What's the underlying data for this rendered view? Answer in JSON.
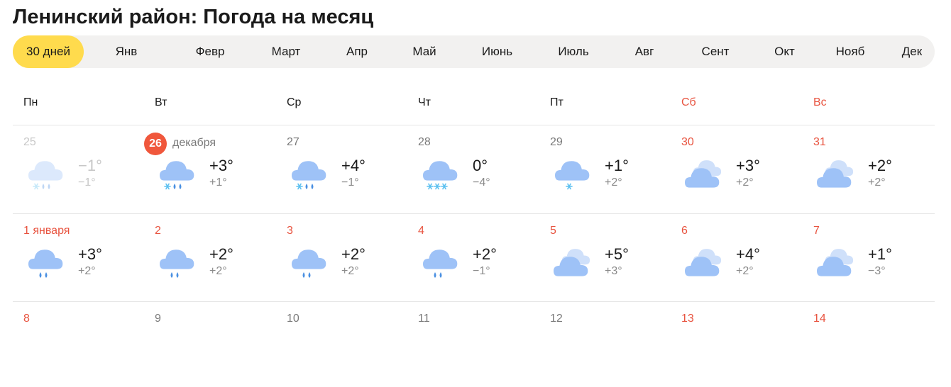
{
  "title": "Ленинский район: Погода на месяц",
  "tabs": [
    "30 дней",
    "Янв",
    "Февр",
    "Март",
    "Апр",
    "Май",
    "Июнь",
    "Июль",
    "Авг",
    "Сент",
    "Окт",
    "Нояб",
    "Дек"
  ],
  "active_tab": 0,
  "weekdays": [
    {
      "label": "Пн",
      "weekend": false
    },
    {
      "label": "Вт",
      "weekend": false
    },
    {
      "label": "Ср",
      "weekend": false
    },
    {
      "label": "Чт",
      "weekend": false
    },
    {
      "label": "Пт",
      "weekend": false
    },
    {
      "label": "Сб",
      "weekend": true
    },
    {
      "label": "Вс",
      "weekend": true
    }
  ],
  "colors": {
    "accent": "#ffdb4d",
    "today": "#f0573c",
    "weekend": "#e8533f",
    "cloud": "#9ec2f7",
    "cloud_back": "#cfe0fa",
    "drop": "#4a90e2",
    "snow": "#5bc0f0"
  },
  "rows": [
    [
      {
        "date": "25",
        "icon": "cloud-snow-rain-icon",
        "tmax": "−1°",
        "tmin": "−1°",
        "past": true
      },
      {
        "date": "26",
        "month": "декабря",
        "today": true,
        "icon": "cloud-snow-rain-icon",
        "tmax": "+3°",
        "tmin": "+1°"
      },
      {
        "date": "27",
        "icon": "cloud-snow-rain-icon",
        "tmax": "+4°",
        "tmin": "−1°"
      },
      {
        "date": "28",
        "icon": "cloud-snow-icon",
        "tmax": "0°",
        "tmin": "−4°"
      },
      {
        "date": "29",
        "icon": "cloud-light-snow-icon",
        "tmax": "+1°",
        "tmin": "+2°"
      },
      {
        "date": "30",
        "icon": "overcast-icon",
        "tmax": "+3°",
        "tmin": "+2°",
        "weekend": true
      },
      {
        "date": "31",
        "icon": "overcast-icon",
        "tmax": "+2°",
        "tmin": "+2°",
        "weekend": true
      }
    ],
    [
      {
        "date": "1 января",
        "icon": "cloud-rain-icon",
        "tmax": "+3°",
        "tmin": "+2°",
        "weekend": true
      },
      {
        "date": "2",
        "icon": "cloud-rain-icon",
        "tmax": "+2°",
        "tmin": "+2°",
        "weekend": true
      },
      {
        "date": "3",
        "icon": "cloud-rain-icon",
        "tmax": "+2°",
        "tmin": "+2°",
        "weekend": true
      },
      {
        "date": "4",
        "icon": "cloud-rain-icon",
        "tmax": "+2°",
        "tmin": "−1°",
        "weekend": true
      },
      {
        "date": "5",
        "icon": "overcast-icon",
        "tmax": "+5°",
        "tmin": "+3°",
        "weekend": true
      },
      {
        "date": "6",
        "icon": "overcast-icon",
        "tmax": "+4°",
        "tmin": "+2°",
        "weekend": true
      },
      {
        "date": "7",
        "icon": "overcast-icon",
        "tmax": "+1°",
        "tmin": "−3°",
        "weekend": true
      }
    ],
    [
      {
        "date": "8",
        "weekend": true
      },
      {
        "date": "9"
      },
      {
        "date": "10"
      },
      {
        "date": "11"
      },
      {
        "date": "12"
      },
      {
        "date": "13",
        "weekend": true
      },
      {
        "date": "14",
        "weekend": true
      }
    ]
  ]
}
